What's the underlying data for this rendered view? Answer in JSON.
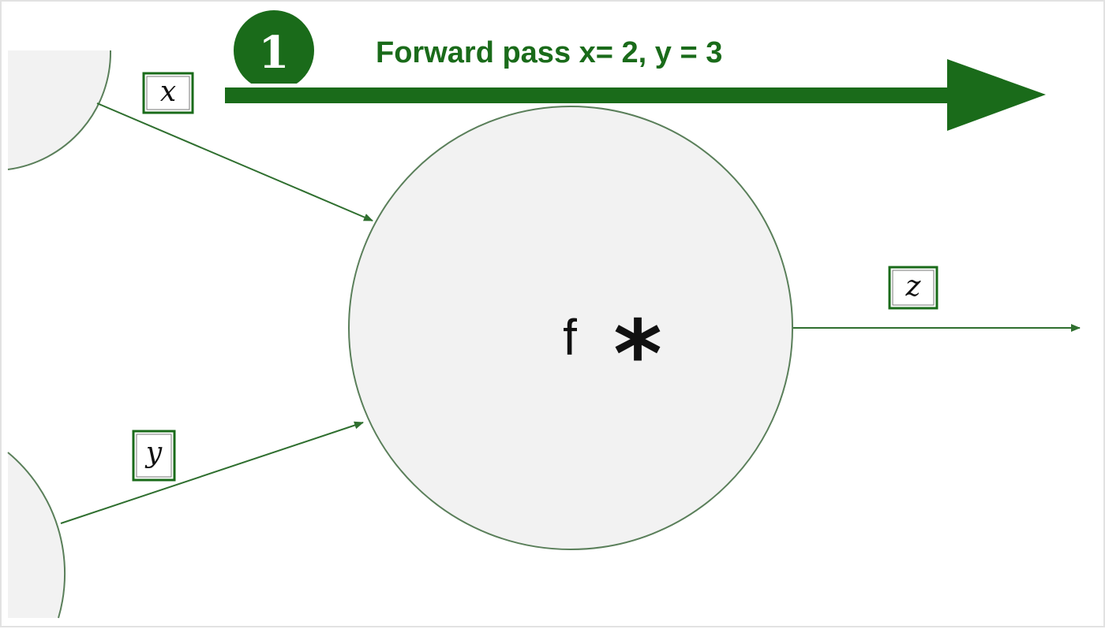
{
  "header": {
    "step_number": "1",
    "title": "Forward pass x= 2, y = 3"
  },
  "labels": {
    "x": "x",
    "y": "y",
    "z": "z"
  },
  "node": {
    "function_label": "f",
    "operator": "*"
  },
  "colors": {
    "accent": "#1a6b1a",
    "edge": "#2f6f2f",
    "node_fill": "#f2f2f2",
    "node_stroke": "#5a7f5a",
    "text_dark": "#111111"
  }
}
